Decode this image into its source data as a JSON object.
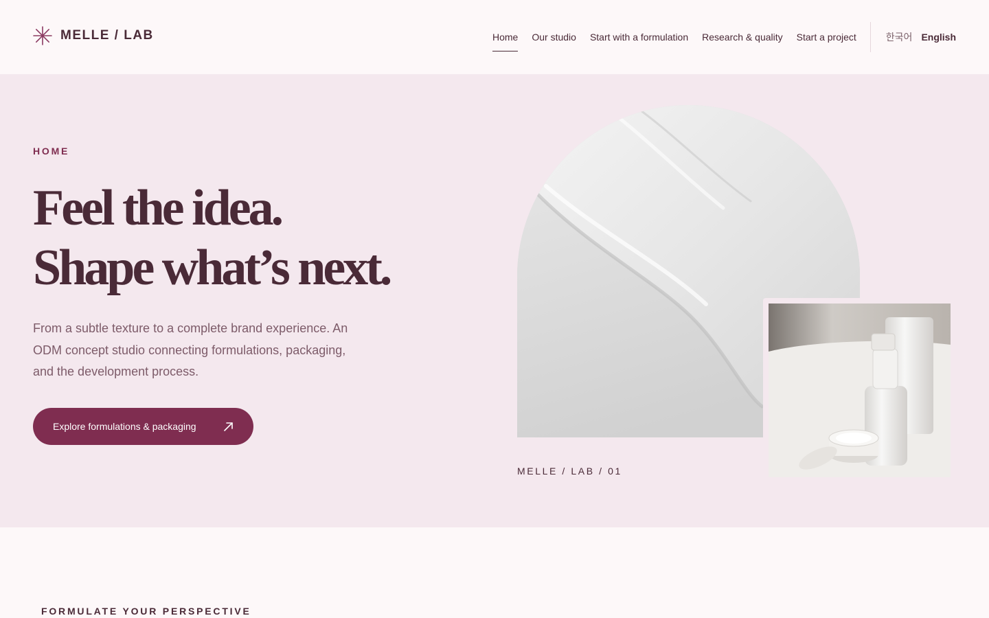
{
  "brand": {
    "name": "MELLE / LAB",
    "logo_icon": "asterisk-icon",
    "accent": "#7f2d50"
  },
  "nav": {
    "items": [
      {
        "label": "Home",
        "active": true
      },
      {
        "label": "Our studio"
      },
      {
        "label": "Start with a formulation"
      },
      {
        "label": "Research & quality"
      },
      {
        "label": "Start a project"
      }
    ],
    "languages": [
      {
        "label": "한국어"
      },
      {
        "label": "English",
        "active": true
      }
    ]
  },
  "hero": {
    "eyebrow": "HOME",
    "headline": [
      "Feel the idea.",
      "Shape what’s next."
    ],
    "body": "From a subtle texture to a complete brand experience. An ODM concept studio connecting formulations, packaging, and the development process.",
    "cta": {
      "label": "Explore formulations & packaging",
      "icon": "arrow-up-right-icon"
    },
    "caption": "MELLE / LAB / 01",
    "images": [
      "cream-texture-image",
      "cosmetic-packaging-image"
    ]
  },
  "next_section": {
    "title": "FORMULATE YOUR PERSPECTIVE"
  }
}
